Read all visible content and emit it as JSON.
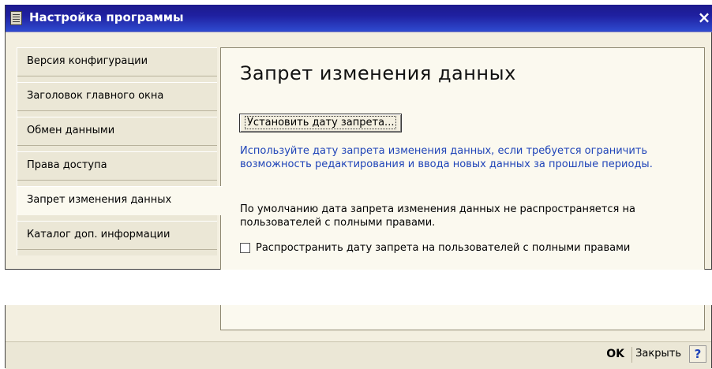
{
  "window": {
    "title": "Настройка программы",
    "close_glyph": "×"
  },
  "tabs": [
    {
      "label": "Версия конфигурации"
    },
    {
      "label": "Заголовок главного окна"
    },
    {
      "label": "Обмен данными"
    },
    {
      "label": "Права доступа"
    },
    {
      "label": "Запрет изменения данных",
      "active": true
    },
    {
      "label": "Каталог доп. информации"
    }
  ],
  "panel": {
    "title": "Запрет изменения данных",
    "set_date_button": "Установить дату запрета...",
    "info_text": "Используйте дату запрета изменения данных, если требуется ограничить возможность редактирования и ввода новых данных за прошлые периоды.",
    "note_text": "По умолчанию дата запрета изменения данных не распространяется на пользователей с полными правами.",
    "checkbox_label": "Распространить дату запрета на пользователей с полными правами",
    "checkbox_checked": false
  },
  "footer": {
    "ok_label": "OK",
    "close_label": "Закрыть",
    "help_glyph": "?"
  },
  "colors": {
    "title_bar": "#1f20a0",
    "link_blue": "#1f44b8",
    "panel_bg": "#fbf9ef"
  }
}
